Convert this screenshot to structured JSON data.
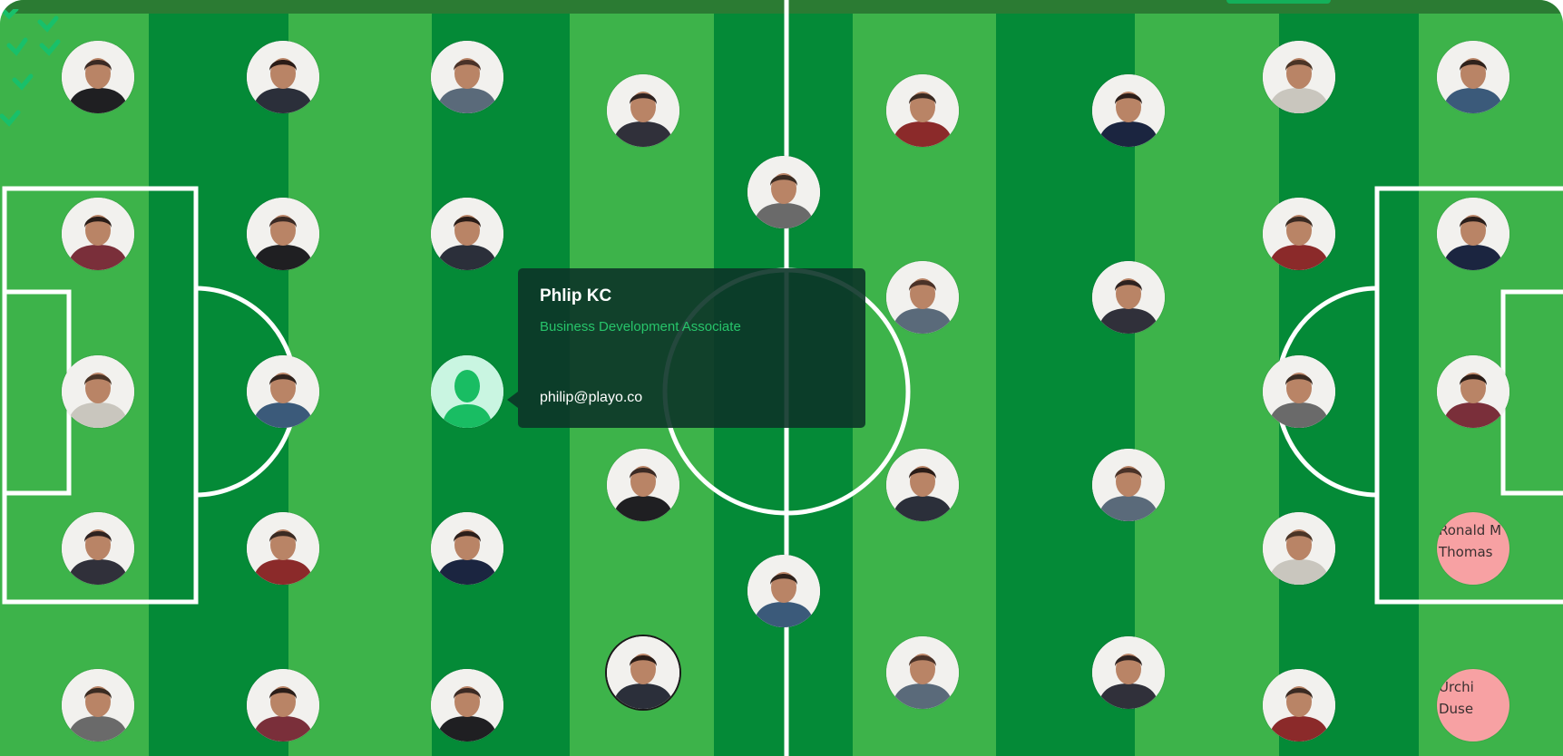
{
  "tooltip": {
    "name": "Phlip KC",
    "role": "Business Development Associate",
    "email": "philip@playo.co"
  },
  "players_without_photo": [
    {
      "name": "Ronald M Thomas"
    },
    {
      "name": "Urchi Duse"
    }
  ],
  "colors": {
    "pitch_light": "#3db34a",
    "pitch_dark": "#048a37",
    "line": "#ffffff",
    "tooltip_bg": "#0c3428",
    "accent_green": "#27c46a",
    "no_photo_bg": "#f7a1a3"
  }
}
